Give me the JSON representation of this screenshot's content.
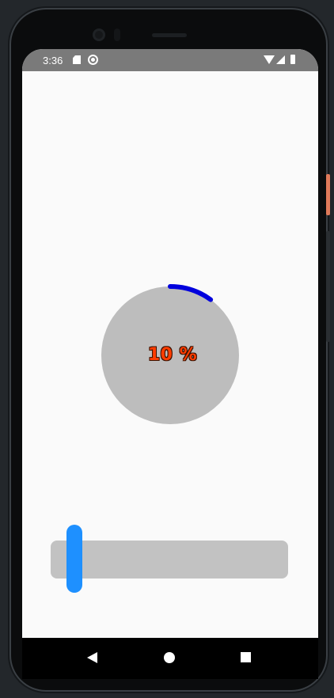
{
  "status_bar": {
    "time": "3:36",
    "icons": [
      "sd-card-icon",
      "sync-icon",
      "wifi-icon",
      "cell-signal-icon",
      "battery-icon"
    ]
  },
  "progress": {
    "value": 10,
    "label": "10 %",
    "arc_color": "#0000dd",
    "circle_color": "#bdbdbd",
    "label_color": "#ff3d00"
  },
  "slider": {
    "value_fraction": 0.1,
    "track_color": "#c2c2c2",
    "thumb_color": "#1e90ff"
  },
  "nav_bar": {
    "buttons": [
      "back-icon",
      "home-icon",
      "recents-icon"
    ]
  }
}
